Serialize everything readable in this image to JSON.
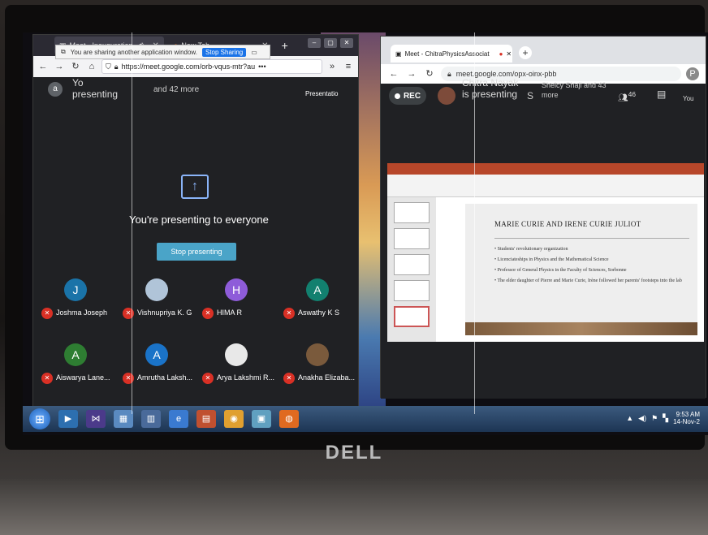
{
  "left_window": {
    "tab_meet": "Meet - Inauguration",
    "tab_new": "New Tab",
    "url": "https://meet.google.com/orb-vqus-mtr?au",
    "share_notice": "You are sharing another application window.",
    "stop_sharing": "Stop Sharing",
    "presenter_initial": "a",
    "presenter_line1": "Yo",
    "presenter_line2": "presenting",
    "more": "and 42 more",
    "presentation_tab": "Presentatio",
    "you_presenting": "You're presenting to everyone",
    "stop_presenting": "Stop presenting",
    "participants": [
      {
        "initial": "J",
        "name": "Joshma Joseph",
        "color": "#1a73a8"
      },
      {
        "initial": "",
        "name": "Vishnupriya K. G",
        "color": "#b0c4d8"
      },
      {
        "initial": "H",
        "name": "HIMA R",
        "color": "#8e5cd9"
      },
      {
        "initial": "A",
        "name": "Aswathy K S",
        "color": "#12806f"
      },
      {
        "initial": "A",
        "name": "Aiswarya Lane...",
        "color": "#2e7d32"
      },
      {
        "initial": "A",
        "name": "Amrutha Laksh...",
        "color": "#1a73c8"
      },
      {
        "initial": "",
        "name": "Arya Lakshmi R...",
        "color": "#e8e8e8"
      },
      {
        "initial": "",
        "name": "Anakha Elizaba...",
        "color": "#7a5a3c"
      }
    ]
  },
  "right_window": {
    "tab": "Meet - ChitraPhysicsAssociat",
    "url": "meet.google.com/opx-oinx-pbb",
    "rec": "REC",
    "presenter": "Chitra Nayak is presenting",
    "s_initial": "S",
    "more": "Shelcy Shaji and 43 more",
    "people_count": "46",
    "you": "You",
    "slide_title": "MARIE CURIE  AND IRENE CURIE JULIOT",
    "bullets": [
      "Students' revolutionary organization",
      "Licenciateships in Physics and the Mathematical Science",
      "Professor of General Physics in the Faculty of Sciences, Sorbonne",
      "The elder daughter of Pierre and Marie Curie, Irène followed her parents' footsteps into the lab"
    ]
  },
  "taskbar": {
    "time": "9:53 AM",
    "date": "14-Nov-2"
  },
  "brand": "DELL"
}
